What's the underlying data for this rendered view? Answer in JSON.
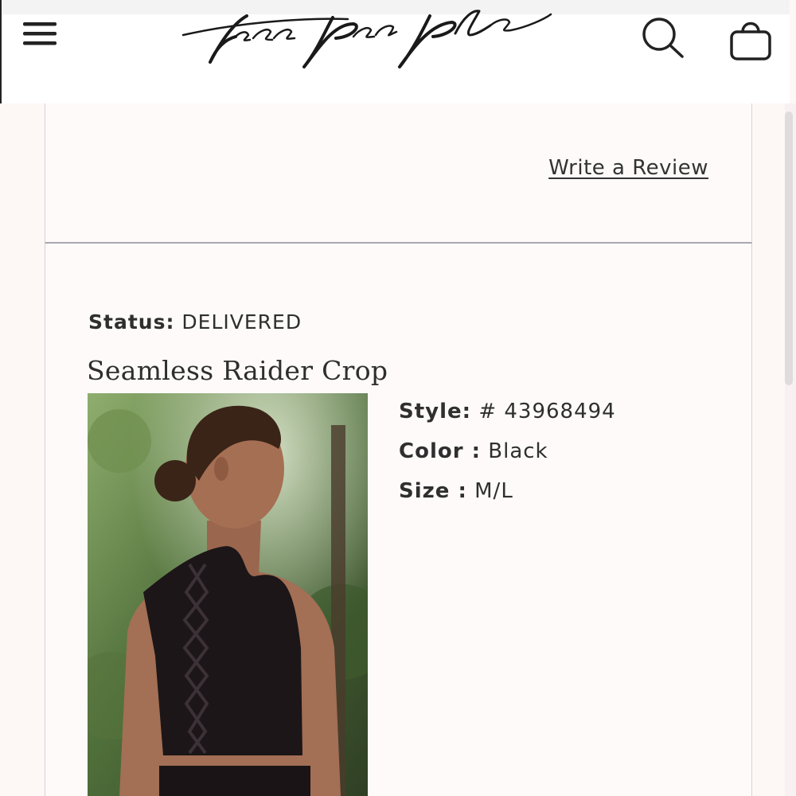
{
  "header": {
    "logo_text": "free people",
    "menu_icon": "hamburger-menu-icon",
    "search_icon": "search-icon",
    "bag_icon": "shopping-bag-icon"
  },
  "review": {
    "write_review_label": "Write a Review"
  },
  "order": {
    "status_label": "Status:",
    "status_value": "DELIVERED",
    "product_name": "Seamless Raider Crop",
    "style_label": "Style:",
    "style_value": "# 43968494",
    "color_label": "Color :",
    "color_value": "Black",
    "size_label": "Size :",
    "size_value": "M/L"
  },
  "colors": {
    "page_bg": "#fdf8f6",
    "header_bg": "#ffffff",
    "text": "#2f2f2f",
    "divider": "#a9a9b0"
  }
}
